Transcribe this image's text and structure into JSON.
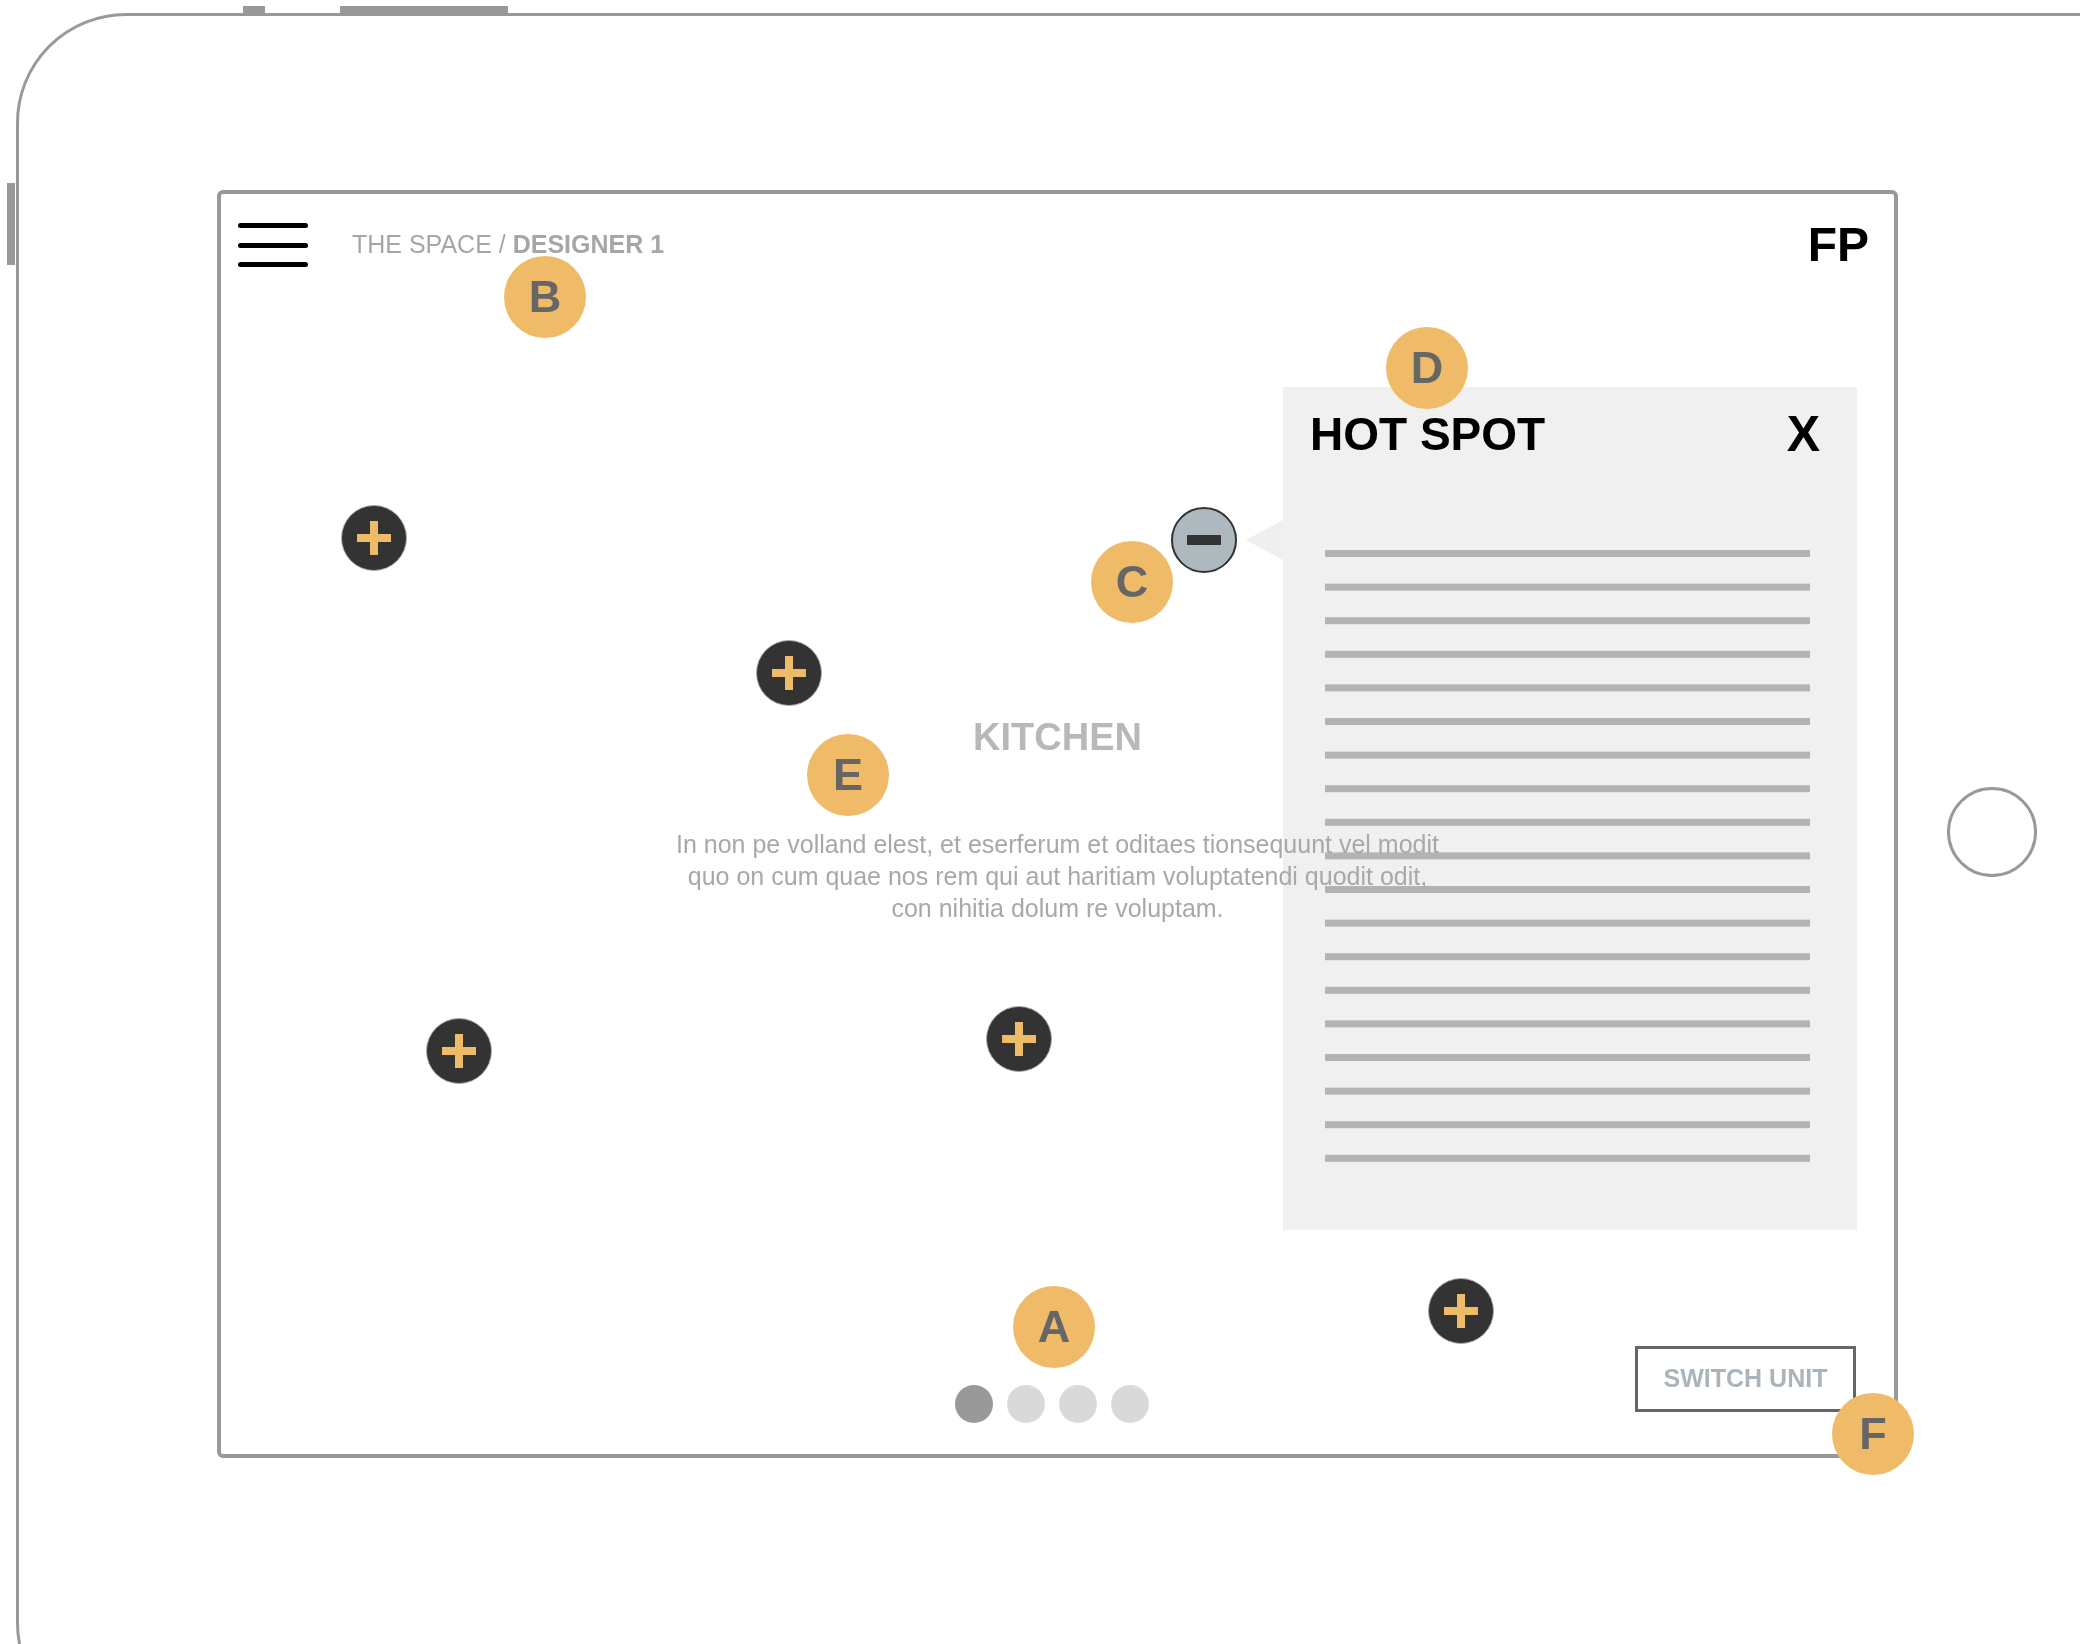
{
  "header": {
    "breadcrumb": {
      "path": "THE SPACE / ",
      "current": "DESIGNER 1"
    },
    "logo": "FP"
  },
  "hotspots": [
    {
      "expanded": false
    },
    {
      "expanded": true
    },
    {
      "expanded": false
    },
    {
      "expanded": false
    },
    {
      "expanded": false
    },
    {
      "expanded": false
    }
  ],
  "room": {
    "title": "KITCHEN",
    "description": "In non pe volland elest, et eserferum et oditaes tionsequunt vel modit quo on cum quae nos rem qui aut haritiam voluptatendi quodit odit, con nihitia dolum re voluptam."
  },
  "panel": {
    "title": "HOT SPOT",
    "close": "X"
  },
  "pager": [
    {
      "selected": true
    },
    {
      "selected": false
    },
    {
      "selected": false
    },
    {
      "selected": false
    }
  ],
  "switch_button": "SWITCH UNIT",
  "annotations": [
    "A",
    "B",
    "C",
    "D",
    "E",
    "F"
  ]
}
